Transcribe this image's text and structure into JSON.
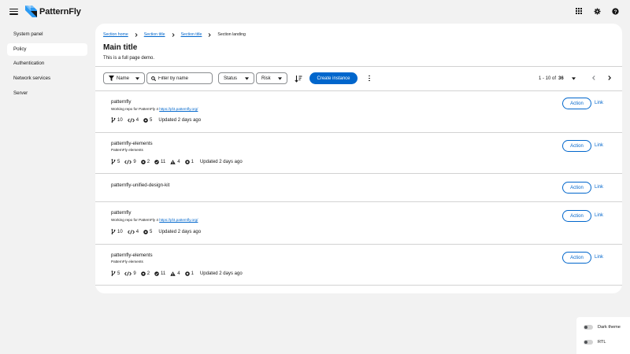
{
  "masthead": {
    "brand": "PatternFly",
    "icons": [
      "hamburger-icon",
      "grid-icon",
      "gear-icon",
      "help-icon"
    ]
  },
  "sidebar": {
    "items": [
      {
        "label": "System panel",
        "active": false
      },
      {
        "label": "Policy",
        "active": true
      },
      {
        "label": "Authentication",
        "active": false
      },
      {
        "label": "Network services",
        "active": false
      },
      {
        "label": "Server",
        "active": false
      }
    ]
  },
  "breadcrumb": {
    "items": [
      "Section home",
      "Section title",
      "Section title"
    ],
    "current": "Section landing"
  },
  "page": {
    "title": "Main title",
    "description": "This is a full page demo."
  },
  "toolbar": {
    "name_filter": "Name",
    "filter_placeholder": "Filter by name",
    "status": "Status",
    "risk": "Risk",
    "create": "Create instance",
    "pagination_range": "1 - 10 of",
    "pagination_total": "36"
  },
  "rows": [
    {
      "title": "patternfly",
      "desc": "Working repo for PatternFly 4",
      "link": "https://pf4.patternfly.org/",
      "stats": {
        "branches": "10",
        "code": "4",
        "layers": "5"
      },
      "updated": "Updated 2 days ago",
      "action": "Action",
      "link_label": "Link"
    },
    {
      "title": "patternfly-elements",
      "desc": "PatternFly elements",
      "stats": {
        "branches": "5",
        "code": "9",
        "layers": "2",
        "check": "11",
        "warning": "4",
        "error": "1"
      },
      "updated": "Updated 2 days ago",
      "action": "Action",
      "link_label": "Link"
    },
    {
      "title": "patternfly-unified-design-kit",
      "action": "Action",
      "link_label": "Link"
    },
    {
      "title": "patternfly",
      "desc": "Working repo for PatternFly 4",
      "link": "https://pf4.patternfly.org/",
      "stats": {
        "branches": "10",
        "code": "4",
        "layers": "5"
      },
      "updated": "Updated 2 days ago",
      "action": "Action",
      "link_label": "Link"
    },
    {
      "title": "patternfly-elements",
      "desc": "PatternFly elements",
      "stats": {
        "branches": "5",
        "code": "9",
        "layers": "2",
        "check": "11",
        "warning": "4",
        "error": "1"
      },
      "updated": "Updated 2 days ago",
      "action": "Action",
      "link_label": "Link"
    }
  ],
  "theme": {
    "dark": "Dark theme",
    "rtl": "RTL"
  },
  "colors": {
    "primary": "#0066cc",
    "background": "#f2f2f2",
    "surface": "#ffffff",
    "border": "#d2d2d2"
  }
}
